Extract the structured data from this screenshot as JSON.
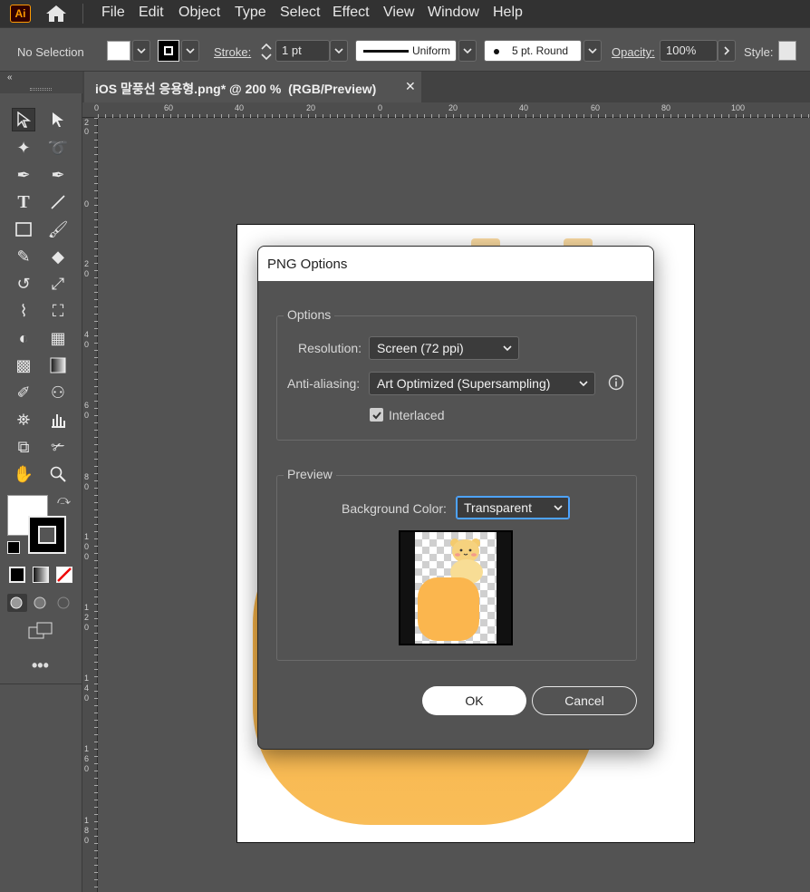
{
  "app": {
    "logo_text": "Ai",
    "brand_color": "#ff9a00"
  },
  "menu": {
    "items": [
      "File",
      "Edit",
      "Object",
      "Type",
      "Select",
      "Effect",
      "View",
      "Window",
      "Help"
    ]
  },
  "control_bar": {
    "selection_label": "No Selection",
    "stroke_label": "Stroke:",
    "stroke_value": "1 pt",
    "profile_label": "Uniform",
    "brush_label": "5 pt. Round",
    "opacity_label": "Opacity:",
    "opacity_value": "100%",
    "style_label": "Style:"
  },
  "document_tab": {
    "title": "iOS 말풍선 응용형.png* @ 200 %  (RGB/Preview)",
    "close": "✕"
  },
  "ruler": {
    "top_labels": [
      "0",
      "60",
      "40",
      "20",
      "0",
      "20",
      "40",
      "60",
      "80",
      "100"
    ],
    "left_labels": [
      "2",
      "0",
      "0",
      "2",
      "0",
      "4",
      "0",
      "6",
      "0",
      "8",
      "0",
      "1",
      "0",
      "0",
      "1",
      "2",
      "0",
      "1",
      "4",
      "0",
      "1",
      "6",
      "0",
      "1",
      "8",
      "0"
    ]
  },
  "dialog": {
    "title": "PNG Options",
    "options_legend": "Options",
    "resolution_label": "Resolution:",
    "resolution_value": "Screen (72 ppi)",
    "antialias_label": "Anti-aliasing:",
    "antialias_value": "Art Optimized (Supersampling)",
    "interlaced_label": "Interlaced",
    "interlaced_checked": true,
    "preview_legend": "Preview",
    "bg_color_label": "Background Color:",
    "bg_color_value": "Transparent",
    "ok_label": "OK",
    "cancel_label": "Cancel"
  },
  "colors": {
    "artwork_orange": "#f9b94e",
    "focus_blue": "#4da3ff"
  }
}
